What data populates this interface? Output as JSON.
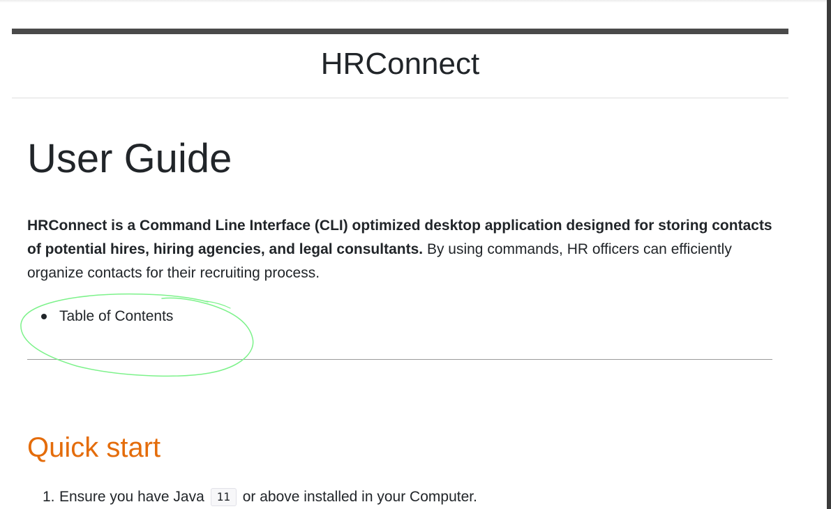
{
  "header": {
    "site_title": "HRConnect"
  },
  "main": {
    "page_title": "User Guide",
    "intro": {
      "bold": "HRConnect is a Command Line Interface (CLI) optimized desktop application designed for storing contacts of potential hires, hiring agencies, and legal consultants.",
      "normal": " By using commands, HR officers can efficiently organize contacts for their recruiting process."
    },
    "toc": {
      "items": [
        "Table of Contents"
      ]
    },
    "quick_start": {
      "title": "Quick start",
      "steps": [
        {
          "number": "1.",
          "before": "Ensure you have Java ",
          "code": "11",
          "after": " or above installed in your Computer."
        }
      ]
    }
  },
  "colors": {
    "top_bar": "#4a4a4a",
    "section_heading": "#e46c0a",
    "annotation_stroke": "#7cf28a"
  }
}
